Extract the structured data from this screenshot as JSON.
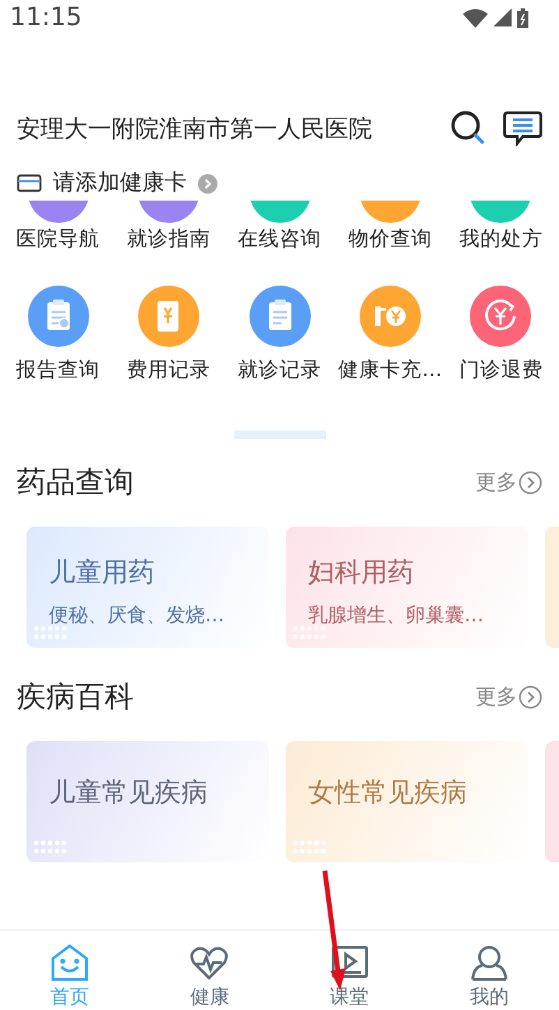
{
  "status_bar": {
    "time": "11:15"
  },
  "header": {
    "title": "安理大一附院淮南市第一人民医院"
  },
  "health_card": {
    "label": "请添加健康卡"
  },
  "services_top": [
    {
      "label": "医院导航",
      "color": "#9a84f2"
    },
    {
      "label": "就诊指南",
      "color": "#9a84f2"
    },
    {
      "label": "在线咨询",
      "color": "#1ccfb0"
    },
    {
      "label": "物价查询",
      "color": "#ffa531"
    },
    {
      "label": "我的处方",
      "color": "#1ccfb0"
    }
  ],
  "services": [
    {
      "label": "报告查询",
      "color": "#5a9ef6",
      "kind": "report"
    },
    {
      "label": "费用记录",
      "color": "#ffa531",
      "kind": "bill"
    },
    {
      "label": "就诊记录",
      "color": "#5a9ef6",
      "kind": "record"
    },
    {
      "label": "健康卡充…",
      "color": "#ffa531",
      "kind": "topup"
    },
    {
      "label": "门诊退费",
      "color": "#fc6478",
      "kind": "refund"
    }
  ],
  "sections": [
    {
      "title": "药品查询",
      "more": "更多",
      "cards": [
        {
          "title": "儿童用药",
          "subtitle": "便秘、厌食、发烧…",
          "color": "#dce9fd"
        },
        {
          "title": "妇科用药",
          "subtitle": "乳腺增生、卵巢囊…",
          "color": "#fde3e7"
        }
      ]
    },
    {
      "title": "疾病百科",
      "more": "更多",
      "cards": [
        {
          "title": "儿童常见疾病",
          "color": "#dfe0f8"
        },
        {
          "title": "女性常见疾病",
          "color": "#fdebd4"
        }
      ]
    }
  ],
  "tab_bar": [
    {
      "label": "首页",
      "selected": true,
      "kind": "home"
    },
    {
      "label": "健康",
      "selected": false,
      "kind": "health"
    },
    {
      "label": "课堂",
      "selected": false,
      "kind": "class"
    },
    {
      "label": "我的",
      "selected": false,
      "kind": "me"
    }
  ]
}
